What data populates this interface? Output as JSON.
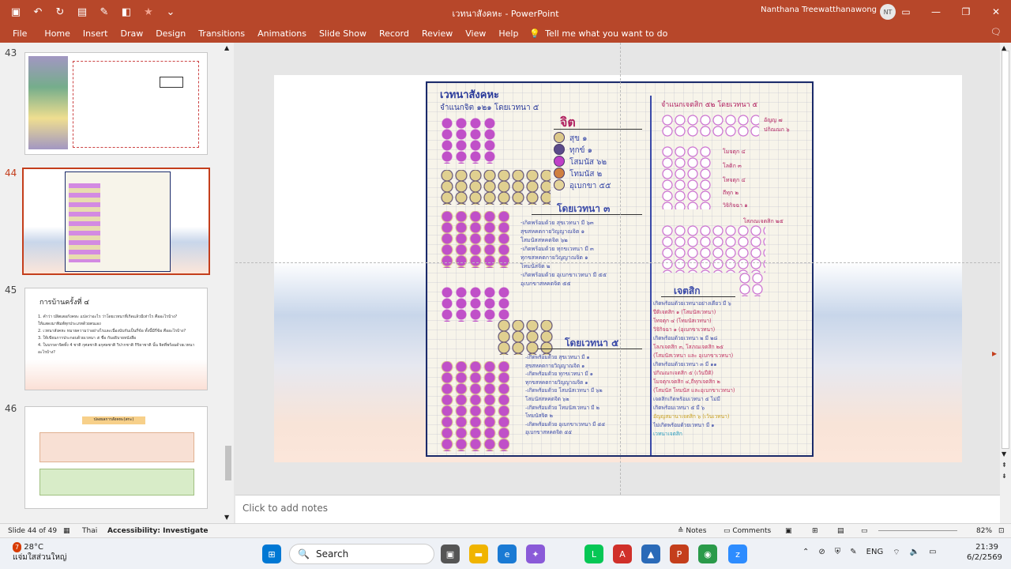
{
  "titlebar": {
    "doc_title": "เวทนาสังคหะ - PowerPoint",
    "user_name": "Nanthana Treewatthanawong",
    "avatar_initials": "NT",
    "qat_icons": [
      "save-icon",
      "undo-icon",
      "redo-icon",
      "slideshow-icon",
      "pen-icon",
      "shapes-icon",
      "star-icon",
      "customize-icon"
    ]
  },
  "ribbon": {
    "tabs": [
      "File",
      "Home",
      "Insert",
      "Draw",
      "Design",
      "Transitions",
      "Animations",
      "Slide Show",
      "Record",
      "Review",
      "View",
      "Help"
    ],
    "tell_me": "Tell me what you want to do"
  },
  "thumbnails": [
    {
      "num": "43"
    },
    {
      "num": "44",
      "selected": true
    },
    {
      "num": "45",
      "title": "การบ้านครั้งที่ ๔",
      "lines": [
        "1. คำว่า ปลิตเตอกังคหะ แปลว่าอะไร ว่าโดยเวทนาที่เกิดแล้วมีเท่าไร คืออะไรบ้าง?",
        "ให้แสดงมาพิมพ์ทุกประเภทด้วยตนเอง",
        "2. เวทนาสังคหะ หมายความว่าอย่างไรและเนื่องนับกันเป็นกี่ข้อ ทั้งนี้มีกี่ข้อ คืออะไรบ้าง?",
        "3. ให้เขียนการประกอบด้วยเวทนา ๕ ชื่อ กับอธิบายหนังสือ",
        "4. ในบรรดาจิตทั้ง 4 ชาติ กุศลชาติ อกุศลชาติ วิปากชาติ กิริยาชาติ นั้น จิตที่พร้อมด้วยเวทนา อะไรบ้าง?"
      ]
    },
    {
      "num": "46",
      "title": "ปลงผลการสังคหะ(สกะ)"
    }
  ],
  "slide": {
    "title": "เวทนาสังคหะ",
    "subtitle": "จำแนกจิต ๑๒๑ โดยเวทนา ๕",
    "jit_heading": "จิต",
    "jit_items": [
      "สุข ๑",
      "ทุกข์ ๑",
      "โสมนัส ๖๒",
      "โทมนัส ๒",
      "อุเบกขา ๕๕"
    ],
    "by3_heading": "โดยเวทนา ๓",
    "by3_lines": [
      "-เกิดพร้อมด้วย สุขเวทนา มี ๖๓",
      "สุขสหคตกายวิญญาณจิต ๑",
      "โสมนัสสหคตจิต ๖๒",
      "-เกิดพร้อมด้วย ทุกขเวทนา มี ๓",
      "ทุกขสหคตกายวิญญาณจิต ๑",
      "โทมนัสจิต ๒",
      "-เกิดพร้อมด้วย อุเบกขาเวทนา มี ๕๕",
      "อุเบกขาสหคตจิต ๕๕"
    ],
    "by5_heading": "โดยเวทนา ๕",
    "by5_lines": [
      "-เกิดพร้อมด้วย สุขเวทนา มี ๑",
      "สุขสหคตกายวิญญาณจิต ๑",
      "-เกิดพร้อมด้วย ทุกขเวทนา มี ๑",
      "ทุกขสหคตกายวิญญาณจิต ๑",
      "-เกิดพร้อมด้วย โสมนัสเวทนา มี ๖๒",
      "โสมนัสสหคตจิต ๖๒",
      "-เกิดพร้อมด้วย โทมนัสเวทนา มี ๒",
      "โทมนัสจิต ๒",
      "-เกิดพร้อมด้วย อุเบกขาเวทนา มี ๕๕",
      "อุเบกขาสหคตจิต ๕๕"
    ],
    "right_heading": "จำแนกเจตสิก ๕๒ โดยเวทนา ๕",
    "right_labels": [
      "อัญญ ๗",
      "ปกิณณก ๖",
      "โมจตุก ๔",
      "โลติก ๓",
      "โทจตุก ๔",
      "ถีทุก ๒",
      "วิจิกิจฉา ๑",
      "โสภณเจตสิก ๒๕"
    ],
    "cetasika_heading": "เจตสิก",
    "cetasika_lines": [
      "เกิดพร้อมด้วยเวทนาอย่างเดียว มี ๖",
      "ปีติเจตสิก ๑ (โสมนัสเวทนา)",
      "โทจตุก ๔ (โทมนัสเวทนา)",
      "วิจิกิจฉา ๑ (อุเบกขาเวทนา)",
      "เกิดพร้อมด้วยเวทนา ๒ มี ๒๘",
      "โลภเจตสิก ๓, โสภณเจตสิก ๒๕",
      "(โสมนัสเวทนา และ อุเบกขาเวทนา)",
      "เกิดพร้อมด้วยเวทนา ๓ มี ๑๑",
      "ปกิณณกเจตสิก ๕ (เว้นปีติ)",
      "โมจตุกเจตสิก ๔,ถีทุกเจตสิก ๒",
      "(โสมนัส โทมนัส และอุเบกขาเวทนา)",
      "เจตสิกเกิดพร้อมเวทนา ๕ ไม่มี",
      "เกิดพร้อมเวทนา ๕ มี ๖",
      "อัญญสมานาเจตสิก ๖ (เว้นเวทนา)",
      "ไม่เกิดพร้อมด้วยเวทนา มี ๑",
      "เวทนาเจตสิก"
    ]
  },
  "notes_placeholder": "Click to add notes",
  "statusbar": {
    "slide_info": "Slide 44 of 49",
    "language": "Thai",
    "accessibility": "Accessibility: Investigate",
    "notes_label": "Notes",
    "comments_label": "Comments",
    "zoom": "82%"
  },
  "taskbar": {
    "temperature": "28°C",
    "weather_text": "แจ่มใสส่วนใหญ่",
    "weather_badge": "7",
    "search_placeholder": "Search",
    "language": "ENG",
    "time": "21:39",
    "date": "6/2/2569"
  },
  "colors": {
    "accent": "#b7472a",
    "selected_border": "#c43e1c",
    "poster_border": "#1a2a6a"
  }
}
